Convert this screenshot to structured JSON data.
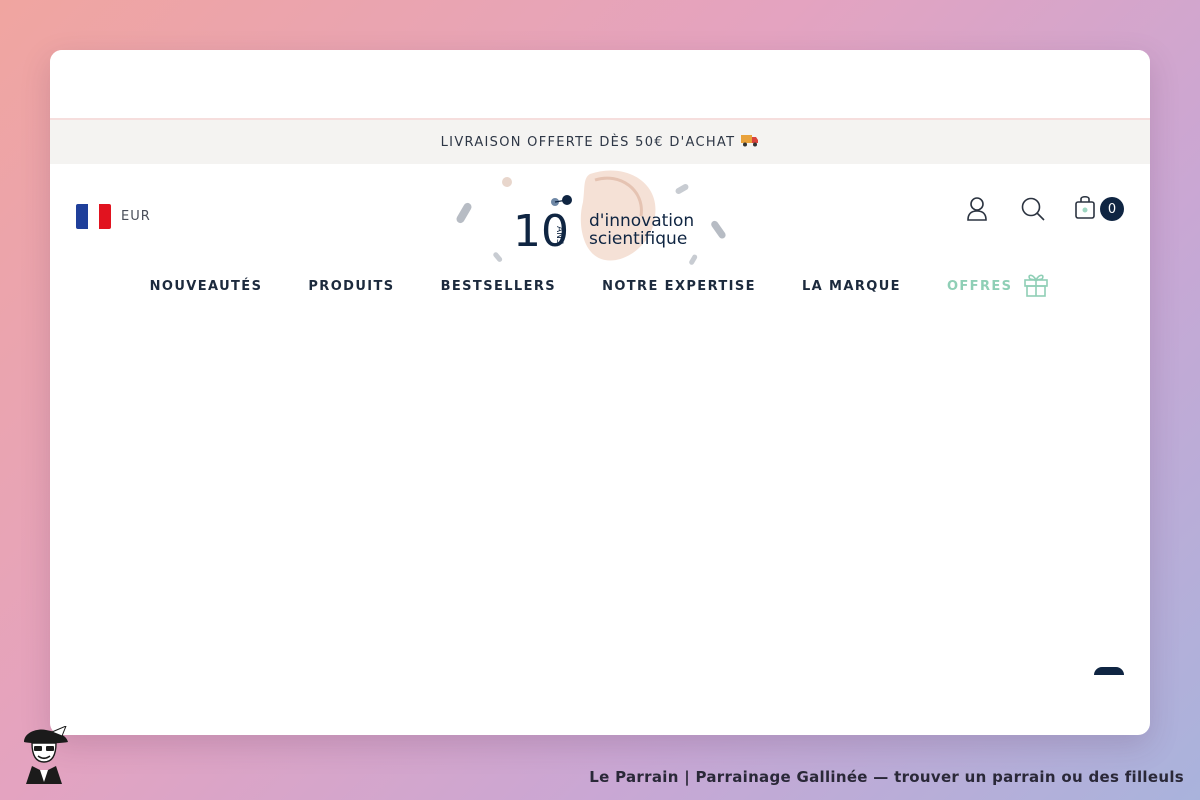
{
  "announcement": {
    "text": "LIVRAISON OFFERTE DÈS 50€ D'ACHAT",
    "icon": "truck-icon"
  },
  "locale": {
    "currency": "EUR",
    "flag": "france-flag-icon"
  },
  "logo": {
    "number": "10",
    "ans": "ANS",
    "line1": "d'innovation",
    "line2": "scientifique"
  },
  "header_icons": {
    "account": "user-icon",
    "search": "search-icon",
    "cart": "bag-icon",
    "cart_count": "0"
  },
  "nav": {
    "items": [
      {
        "label": "NOUVEAUTÉS"
      },
      {
        "label": "PRODUITS"
      },
      {
        "label": "BESTSELLERS"
      },
      {
        "label": "NOTRE EXPERTISE"
      },
      {
        "label": "LA MARQUE"
      },
      {
        "label": "OFFRES",
        "icon": "gift-icon"
      }
    ]
  },
  "colors": {
    "brand_navy": "#0f2542",
    "offers_green": "#8fcfb6",
    "announce_bg": "#f4f3f1"
  },
  "footer": {
    "caption": "Le Parrain | Parrainage Gallinée — trouver un parrain ou des filleuls"
  }
}
